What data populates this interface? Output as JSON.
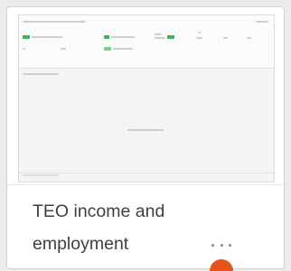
{
  "card": {
    "title": "TEO income and employment",
    "more_label": "...",
    "accent_color": "#3cb44b",
    "indicator_color": "#e8521b"
  },
  "icons": {
    "more": "more-options-icon",
    "cursor": "cursor-indicator"
  }
}
